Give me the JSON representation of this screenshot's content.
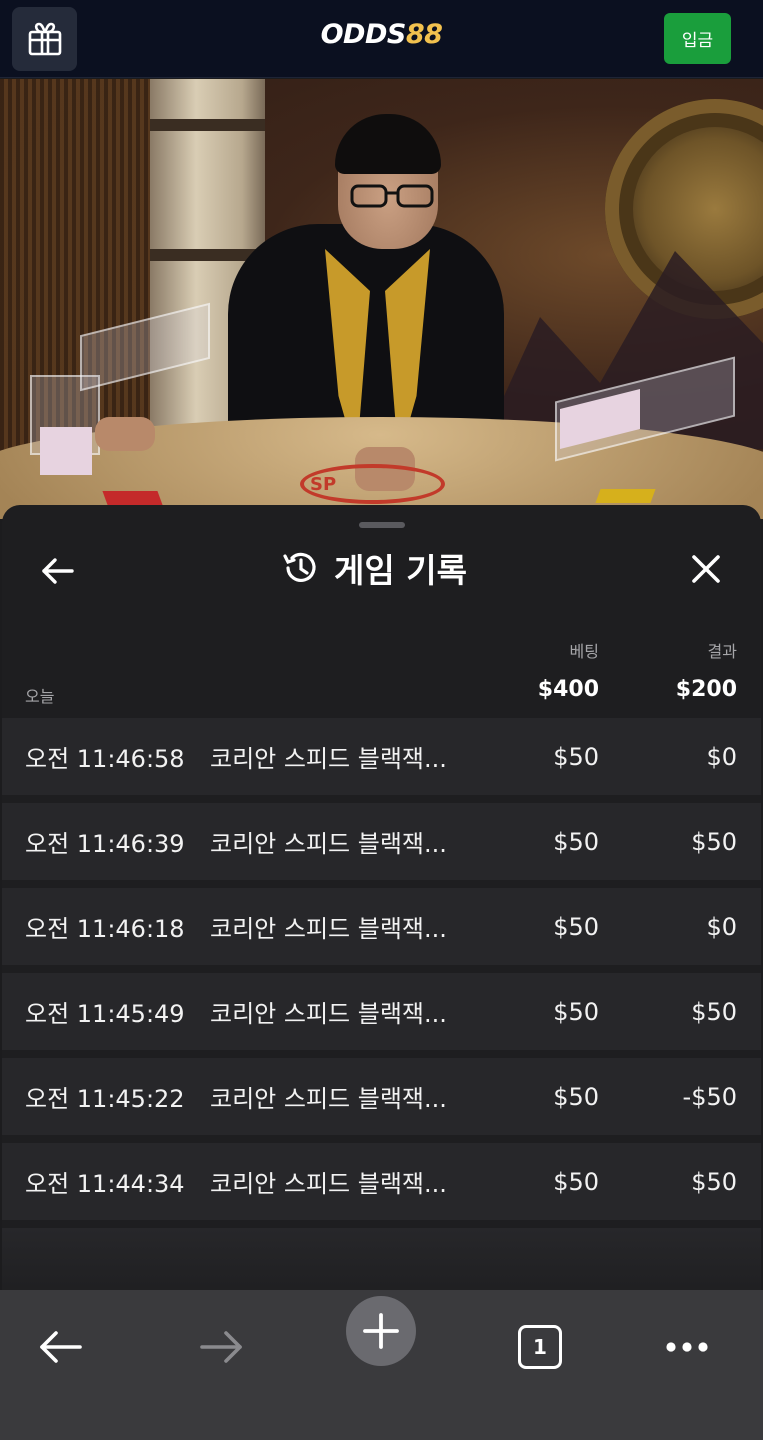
{
  "header": {
    "logo_part1": "ODDS",
    "logo_part2": "88",
    "deposit_label": "입금",
    "logo_accent_color": "#f2c14e",
    "deposit_color": "#1a9e3c"
  },
  "video": {
    "table_text": "SP"
  },
  "history": {
    "title": "게임 기록",
    "col_bet": "베팅",
    "col_result": "결과",
    "group_label": "오늘",
    "total_bet": "$400",
    "total_result": "$200",
    "rows": [
      {
        "time": "오전 11:46:58",
        "game": "코리안 스피드 블랙잭...",
        "bet": "$50",
        "result": "$0"
      },
      {
        "time": "오전 11:46:39",
        "game": "코리안 스피드 블랙잭...",
        "bet": "$50",
        "result": "$50"
      },
      {
        "time": "오전 11:46:18",
        "game": "코리안 스피드 블랙잭...",
        "bet": "$50",
        "result": "$0"
      },
      {
        "time": "오전 11:45:49",
        "game": "코리안 스피드 블랙잭...",
        "bet": "$50",
        "result": "$50"
      },
      {
        "time": "오전 11:45:22",
        "game": "코리안 스피드 블랙잭...",
        "bet": "$50",
        "result": "-$50"
      },
      {
        "time": "오전 11:44:34",
        "game": "코리안 스피드 블랙잭...",
        "bet": "$50",
        "result": "$50"
      }
    ]
  },
  "browser": {
    "tab_count": "1",
    "icons": [
      "back-arrow-icon",
      "forward-arrow-icon",
      "plus-icon",
      "tabs-icon",
      "more-icon"
    ]
  }
}
